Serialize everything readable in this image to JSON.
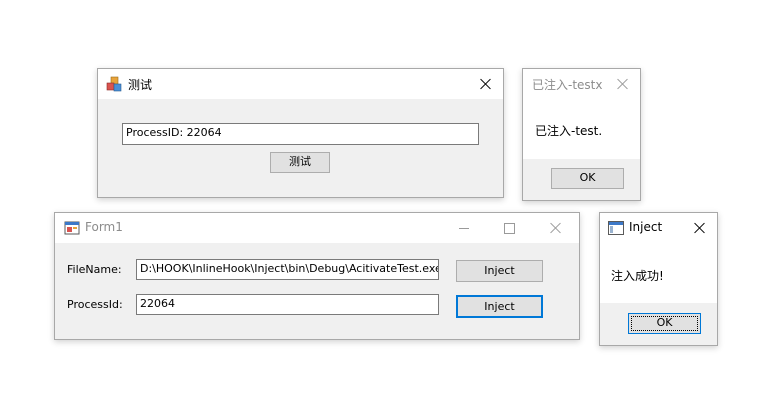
{
  "windows": {
    "test": {
      "title": "测试",
      "process_text": "ProcessID: 22064",
      "button_label": "测试"
    },
    "injected_msg": {
      "title": "已注入-testx",
      "message": "已注入-test.",
      "ok_label": "OK"
    },
    "form1": {
      "title": "Form1",
      "filename_label": "FileName:",
      "filename_value": "D:\\HOOK\\InlineHook\\Inject\\bin\\Debug\\AcitivateTest.exe",
      "inject_button_1": "Inject",
      "processid_label": "ProcessId:",
      "processid_value": "22064",
      "inject_button_2": "Inject"
    },
    "inject_msg": {
      "title": "Inject",
      "message": "注入成功!",
      "ok_label": "OK"
    }
  },
  "colors": {
    "focus_blue": "#0078d7",
    "window_bg": "#f0f0f0",
    "button_bg": "#e1e1e1"
  }
}
